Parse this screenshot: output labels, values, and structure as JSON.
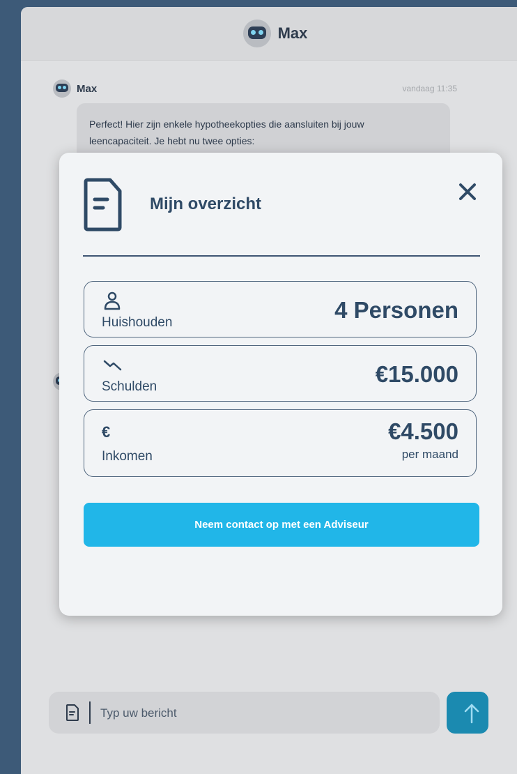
{
  "header": {
    "title": "Max"
  },
  "message": {
    "sender": "Max",
    "time": "vandaag 11:35",
    "line1": "Perfect! Hier zijn enkele hypotheekopties die aansluiten bij jouw",
    "line2": "leencapaciteit. Je hebt nu twee opties:"
  },
  "modal": {
    "title": "Mijn overzicht",
    "cards": [
      {
        "label": "Huishouden",
        "value": "4 Personen",
        "icon": "person-icon"
      },
      {
        "label": "Schulden",
        "value": "€15.000",
        "icon": "trend-down-icon"
      },
      {
        "label": "Inkomen",
        "value": "€4.500",
        "sub": "per maand",
        "icon": "euro-icon",
        "icon_glyph": "€"
      }
    ],
    "cta_label": "Neem contact op met een Adviseur"
  },
  "composer": {
    "placeholder": "Typ uw bericht"
  },
  "colors": {
    "accent": "#21b6e8",
    "send": "#1b8ab0",
    "text": "#2f4a66"
  }
}
